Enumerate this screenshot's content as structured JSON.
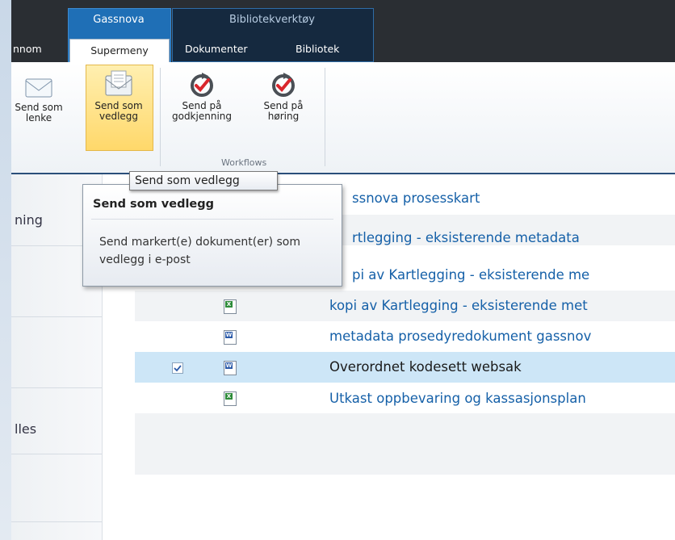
{
  "ribbon": {
    "context_groups": [
      {
        "label": "Gassnova"
      },
      {
        "label": "Bibliotekverktøy"
      }
    ],
    "tabs": [
      {
        "label": "nnom"
      },
      {
        "label": "Supermeny"
      },
      {
        "label": "Dokumenter"
      },
      {
        "label": "Bibliotek"
      }
    ],
    "buttons": [
      {
        "line1": "Send som",
        "line2": "lenke",
        "icon": "envelope-icon"
      },
      {
        "line1": "Send som",
        "line2": "vedlegg",
        "icon": "envelope-attachment-icon"
      },
      {
        "line1": "Send på",
        "line2": "godkjenning",
        "icon": "workflow-approval-icon"
      },
      {
        "line1": "Send på",
        "line2": "høring",
        "icon": "workflow-hearing-icon"
      }
    ],
    "group_label": "Workflows"
  },
  "tooltip": {
    "small": "Send som vedlegg",
    "title": "Send som vedlegg",
    "body": "Send markert(e) dokument(er) som vedlegg i e-post"
  },
  "leftnav": {
    "items": [
      {
        "label": "ning"
      },
      {
        "label": "lles"
      }
    ]
  },
  "documents": [
    {
      "name": "ssnova prosesskart",
      "type": "none"
    },
    {
      "name": "rtlegging - eksisterende metadata",
      "type": "none"
    },
    {
      "name": "pi av Kartlegging - eksisterende me",
      "type": "none"
    },
    {
      "name": "kopi av Kartlegging - eksisterende met",
      "type": "excel"
    },
    {
      "name": "metadata prosedyredokument gassnov",
      "type": "word"
    },
    {
      "name": "Overordnet kodesett websak",
      "type": "word",
      "selected": true
    },
    {
      "name": "Utkast oppbevaring og kassasjonsplan",
      "type": "excel"
    }
  ],
  "colors": {
    "accent": "#1f6fb6",
    "link": "#1560a8",
    "selection": "#cde6f7"
  }
}
